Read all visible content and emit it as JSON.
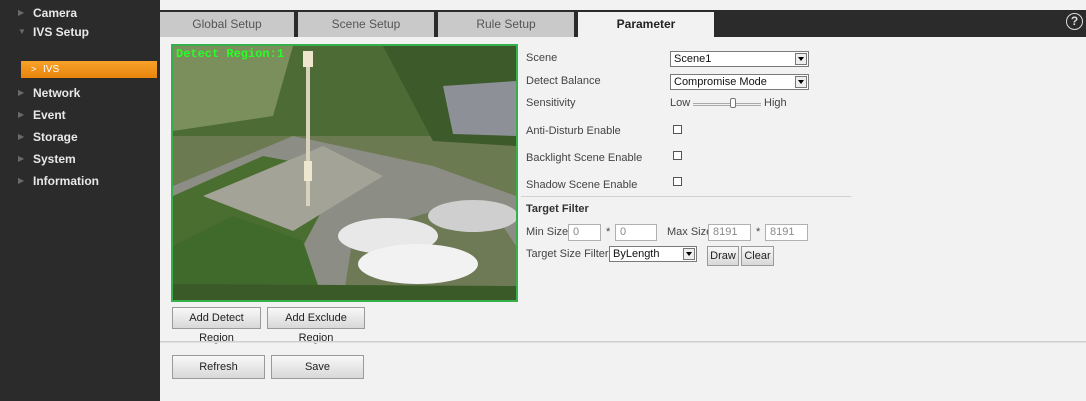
{
  "sidebar": {
    "items": [
      {
        "label": "Camera"
      },
      {
        "label": "IVS Setup"
      },
      {
        "label": "Network"
      },
      {
        "label": "Event"
      },
      {
        "label": "Storage"
      },
      {
        "label": "System"
      },
      {
        "label": "Information"
      }
    ],
    "active_sub": "IVS"
  },
  "tabs": [
    {
      "label": "Global Setup"
    },
    {
      "label": "Scene Setup"
    },
    {
      "label": "Rule Setup"
    },
    {
      "label": "Parameter"
    }
  ],
  "help_glyph": "?",
  "video": {
    "overlay": "Detect Region:1"
  },
  "video_buttons": {
    "add_detect": "Add Detect Region",
    "add_exclude": "Add Exclude Region"
  },
  "params": {
    "scene": {
      "label": "Scene",
      "value": "Scene1"
    },
    "detect_balance": {
      "label": "Detect Balance",
      "value": "Compromise Mode"
    },
    "sensitivity": {
      "label": "Sensitivity",
      "low": "Low",
      "high": "High",
      "level": 0.6
    },
    "anti_disturb": {
      "label": "Anti-Disturb Enable",
      "checked": false
    },
    "backlight": {
      "label": "Backlight Scene Enable",
      "checked": false
    },
    "shadow": {
      "label": "Shadow Scene Enable",
      "checked": false
    }
  },
  "target_filter": {
    "title": "Target Filter",
    "min_label": "Min Size",
    "min_w": "0",
    "min_h": "0",
    "times": "*",
    "max_label": "Max Size",
    "max_w": "8191",
    "max_h": "8191",
    "size_filter_label": "Target Size Filter",
    "size_filter_value": "ByLength",
    "draw": "Draw",
    "clear": "Clear"
  },
  "footer": {
    "refresh": "Refresh",
    "save": "Save"
  }
}
